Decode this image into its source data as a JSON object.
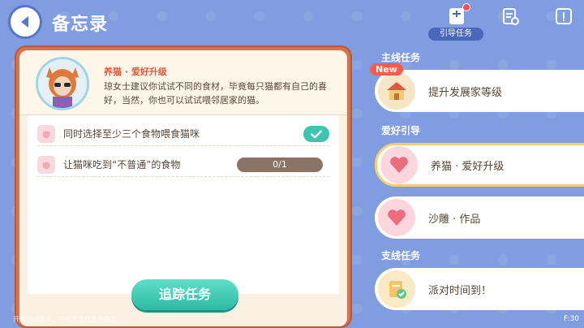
{
  "header": {
    "title": "备忘录",
    "guide_label": "引导任务"
  },
  "task": {
    "name": "养猫 · 爱好升级",
    "description": "琼女士建议你试试不同的食材，毕竟每只猫都有自己的喜好，当然，你也可以试试喂邻居家的猫。",
    "objectives": [
      {
        "text": "同时选择至少三个食物喂食猫咪",
        "status": "completed"
      },
      {
        "text": "让猫咪吃到“不普通”的食物",
        "progress": "0/1"
      }
    ],
    "track_button": "追踪任务"
  },
  "sidebar": {
    "sections": [
      {
        "title": "主线任务"
      },
      {
        "title": "爱好引导"
      },
      {
        "title": "支线任务"
      }
    ],
    "items": [
      {
        "label": "提升发展家等级",
        "badge": "New",
        "icon": "house-icon"
      },
      {
        "label": "养猫 · 爱好升级",
        "icon": "heart-icon",
        "selected": true
      },
      {
        "label": "沙雕 · 作品",
        "icon": "heart-icon"
      },
      {
        "label": "派对时间到！",
        "icon": "note-check-icon"
      }
    ]
  },
  "footer": {
    "note": "开发测试版本，不代表游戏最终品质",
    "fps": "F:30"
  },
  "colors": {
    "background": "#7f9de0",
    "panel_border": "#d9734a",
    "track_button": "#3cc6b2",
    "selected_border": "#f4d066"
  }
}
